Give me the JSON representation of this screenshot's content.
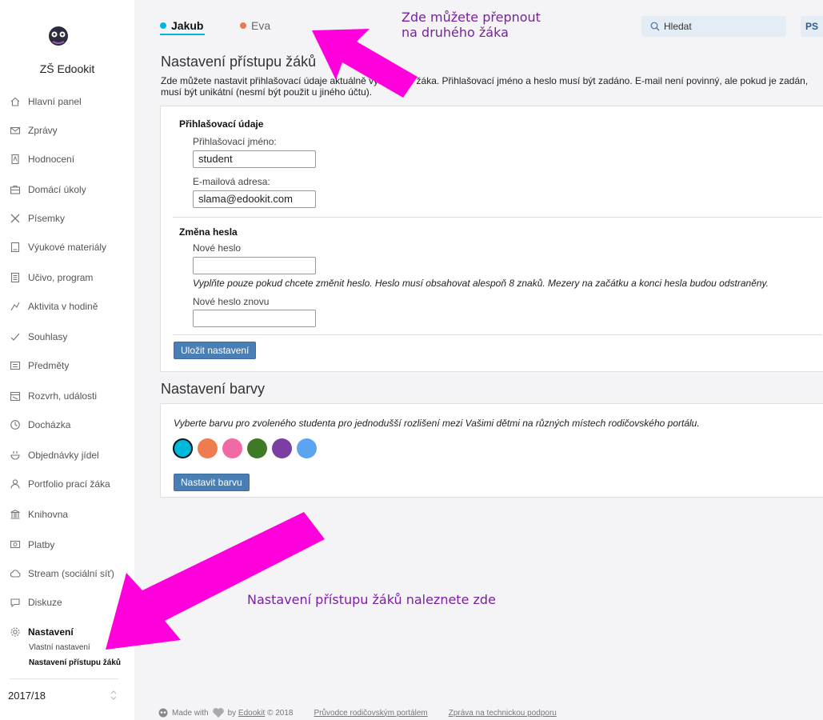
{
  "school": {
    "name": "ZŠ Edookit"
  },
  "sidebar": {
    "items": [
      {
        "label": "Hlavní panel",
        "icon": "home-icon"
      },
      {
        "label": "Zprávy",
        "icon": "mail-icon"
      },
      {
        "label": "Hodnocení",
        "icon": "grade-icon"
      },
      {
        "label": "Domácí úkoly",
        "icon": "homework-icon"
      },
      {
        "label": "Písemky",
        "icon": "exam-icon"
      },
      {
        "label": "Výukové materiály",
        "icon": "materials-icon"
      },
      {
        "label": "Učivo, program",
        "icon": "curriculum-icon"
      },
      {
        "label": "Aktivita v hodině",
        "icon": "activity-icon"
      },
      {
        "label": "Souhlasy",
        "icon": "consent-icon"
      },
      {
        "label": "Předměty",
        "icon": "subjects-icon"
      },
      {
        "label": "Rozvrh, události",
        "icon": "calendar-icon"
      },
      {
        "label": "Docházka",
        "icon": "clock-icon"
      },
      {
        "label": "Objednávky jídel",
        "icon": "meal-icon"
      },
      {
        "label": "Portfolio prací žáka",
        "icon": "person-icon"
      },
      {
        "label": "Knihovna",
        "icon": "library-icon"
      },
      {
        "label": "Platby",
        "icon": "payment-icon"
      },
      {
        "label": "Stream (sociální síť)",
        "icon": "cloud-icon"
      },
      {
        "label": "Diskuze",
        "icon": "chat-icon"
      },
      {
        "label": "Nastavení",
        "icon": "gear-icon"
      }
    ],
    "subitems": [
      {
        "label": "Vlastní nastavení"
      },
      {
        "label": "Nastavení přístupu žáků"
      }
    ],
    "year": "2017/18"
  },
  "header": {
    "students": [
      {
        "name": "Jakub",
        "color": "#00b8d9"
      },
      {
        "name": "Eva",
        "color": "#e87a4b"
      }
    ],
    "search_placeholder": "Hledat",
    "user_initials": "PS"
  },
  "access": {
    "title": "Nastavení přístupu žáků",
    "description": "Zde můžete nastavit přihlašovací údaje aktuálně vybraného žáka. Přihlašovací jméno a heslo musí být zadáno. E-mail není povinný, ale pokud je zadán, musí být unikátní (nesmí být použit u jiného účtu).",
    "login_section": "Přihlašovací údaje",
    "username_label": "Přihlašovací jméno:",
    "username_value": "student",
    "email_label": "E-mailová adresa:",
    "email_value": "slama@edookit.com",
    "password_section": "Změna hesla",
    "new_password_label": "Nové heslo",
    "password_note": "Vyplňte pouze pokud chcete změnit heslo. Heslo musí obsahovat alespoň 8 znaků. Mezery na začátku a konci hesla budou odstraněny.",
    "repeat_password_label": "Nové heslo znovu",
    "save_button": "Uložit nastavení"
  },
  "color": {
    "title": "Nastavení barvy",
    "description": "Vyberte barvu pro zvoleného studenta pro jednodušší rozlišení mezi Vašimi dětmi na různých místech rodičovského portálu.",
    "swatches": [
      "#00b8d9",
      "#ef7c4f",
      "#f26aa5",
      "#3e7a26",
      "#7b3fa3",
      "#5ba5f0"
    ],
    "selected": 0,
    "button": "Nastavit barvu"
  },
  "annotations": {
    "switch_student_line1": "Zde můžete přepnout",
    "switch_student_line2": "na druhého žáka",
    "access_location": "Nastavení přístupu žáků naleznete zde",
    "arrow_color": "#ff00dc"
  },
  "footer": {
    "made_with": "Made with",
    "by": "by",
    "brand": "Edookit",
    "year": "© 2018",
    "guide": "Průvodce rodičovským portálem",
    "support": "Zpráva na technickou podporu"
  }
}
